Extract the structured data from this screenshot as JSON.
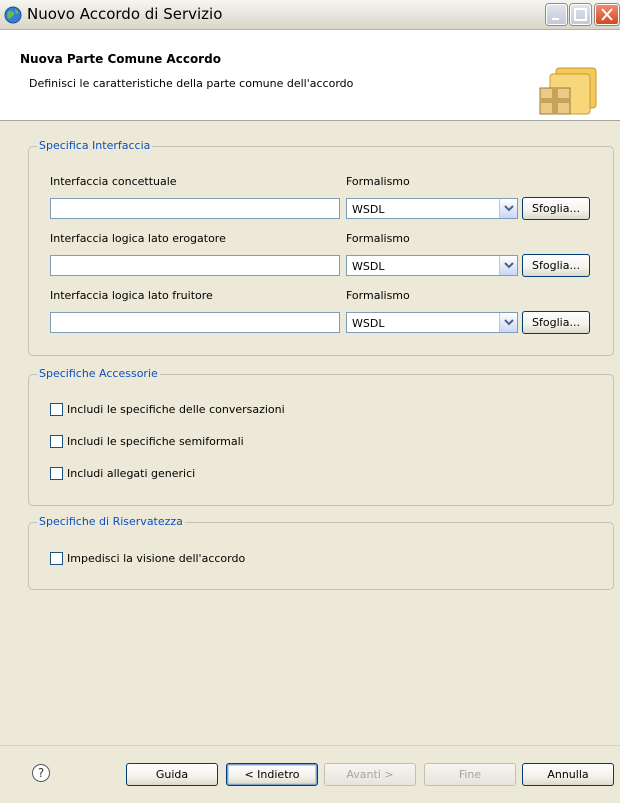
{
  "window": {
    "title": "Nuovo Accordo di Servizio"
  },
  "header": {
    "title": "Nuova Parte Comune Accordo",
    "description": "Definisci le caratteristiche della parte comune dell'accordo"
  },
  "interface_group": {
    "title": "Specifica Interfaccia",
    "rows": [
      {
        "label": "Interfaccia concettuale",
        "formalism_label": "Formalismo",
        "value": "",
        "formalism": "WSDL",
        "browse_label": "Sfoglia..."
      },
      {
        "label": "Interfaccia logica lato erogatore",
        "formalism_label": "Formalismo",
        "value": "",
        "formalism": "WSDL",
        "browse_label": "Sfoglia..."
      },
      {
        "label": "Interfaccia logica lato fruitore",
        "formalism_label": "Formalismo",
        "value": "",
        "formalism": "WSDL",
        "browse_label": "Sfoglia..."
      }
    ]
  },
  "accessory_group": {
    "title": "Specifiche Accessorie",
    "options": [
      {
        "label": "Includi le specifiche delle conversazioni",
        "checked": false
      },
      {
        "label": "Includi le specifiche semiformali",
        "checked": false
      },
      {
        "label": "Includi allegati generici",
        "checked": false
      }
    ]
  },
  "privacy_group": {
    "title": "Specifiche di Riservatezza",
    "options": [
      {
        "label": "Impedisci la visione dell'accordo",
        "checked": false
      }
    ]
  },
  "footer": {
    "help_icon": "question-mark-icon",
    "help_glyph": "?",
    "guide_label": "Guida",
    "back_label": "< Indietro",
    "next_label": "Avanti >",
    "finish_label": "Fine",
    "cancel_label": "Annulla"
  },
  "colors": {
    "group_title": "#0a4fc3",
    "window_bg": "#ece9d8"
  }
}
